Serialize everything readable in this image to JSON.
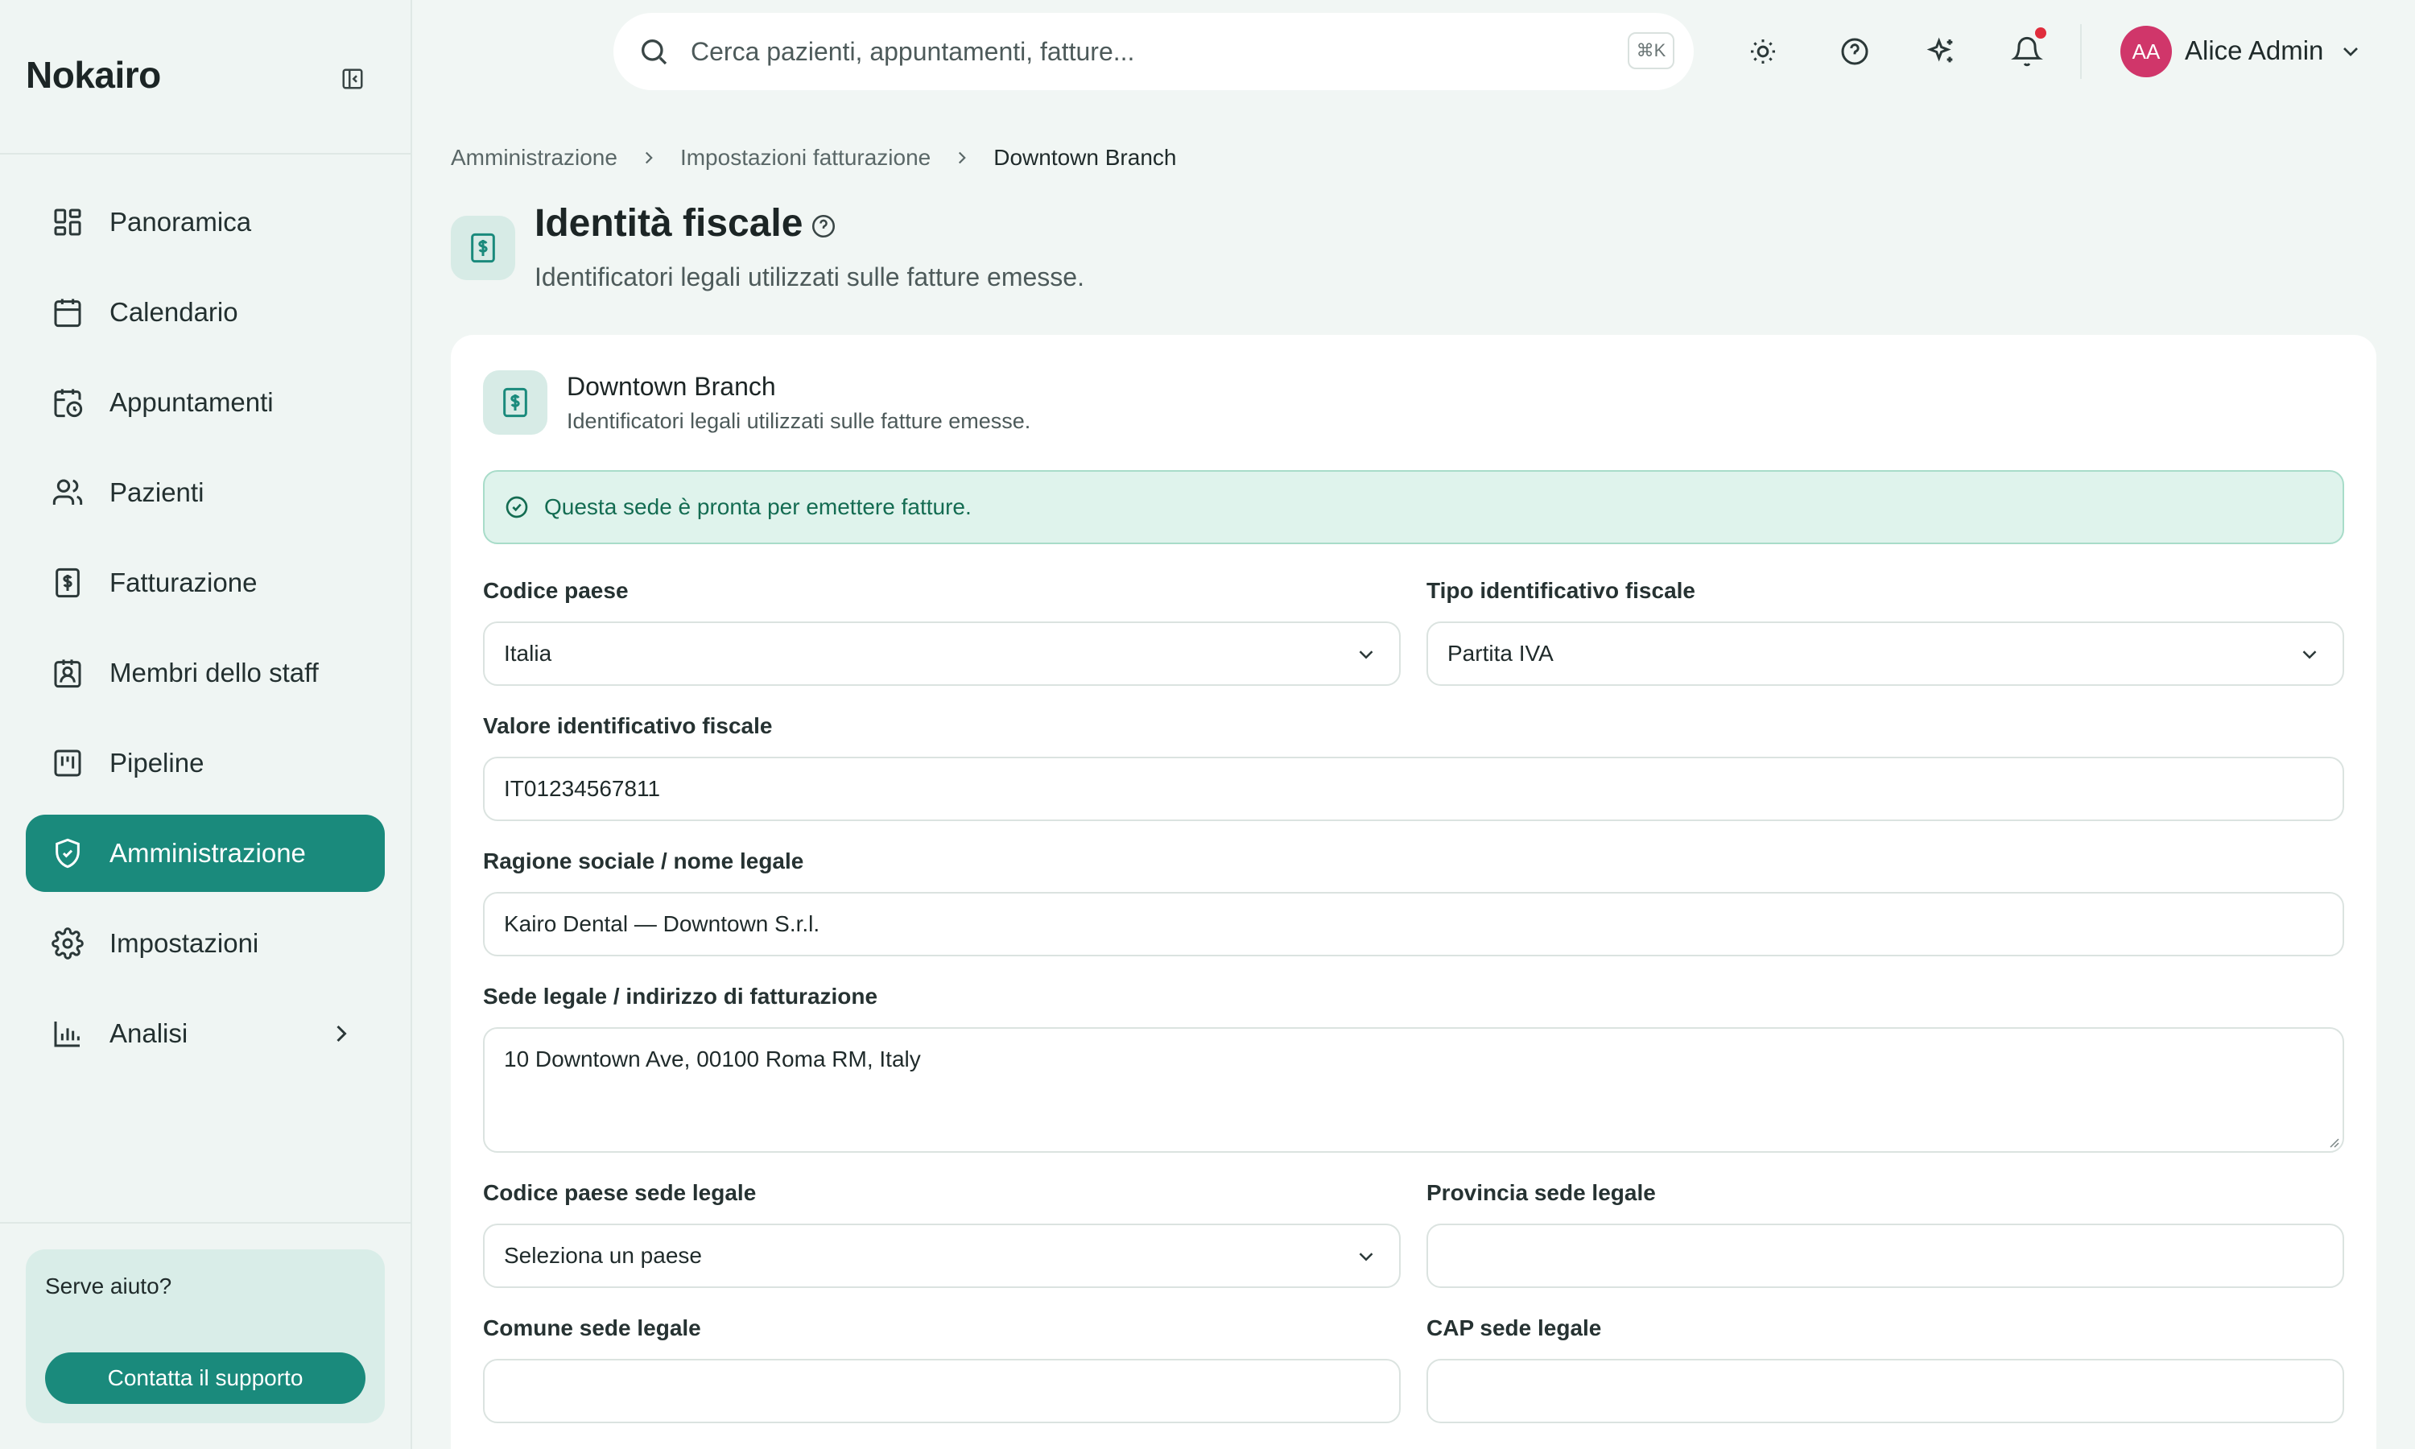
{
  "app": {
    "brand": "Nokairo"
  },
  "sidebar": {
    "items": [
      {
        "label": "Panoramica",
        "icon": "dashboard-icon"
      },
      {
        "label": "Calendario",
        "icon": "calendar-icon"
      },
      {
        "label": "Appuntamenti",
        "icon": "calendar-clock-icon"
      },
      {
        "label": "Pazienti",
        "icon": "users-icon"
      },
      {
        "label": "Fatturazione",
        "icon": "receipt-icon"
      },
      {
        "label": "Membri dello staff",
        "icon": "id-badge-icon"
      },
      {
        "label": "Pipeline",
        "icon": "kanban-icon"
      },
      {
        "label": "Amministrazione",
        "icon": "shield-icon",
        "active": true
      },
      {
        "label": "Impostazioni",
        "icon": "gear-icon"
      },
      {
        "label": "Analisi",
        "icon": "bar-chart-icon"
      }
    ],
    "help": {
      "title": "Serve aiuto?",
      "button": "Contatta il supporto"
    }
  },
  "topbar": {
    "search_placeholder": "Cerca pazienti, appuntamenti, fatture...",
    "shortcut": "⌘K",
    "user": {
      "initials": "AA",
      "name": "Alice Admin"
    }
  },
  "breadcrumb": [
    "Amministrazione",
    "Impostazioni fatturazione",
    "Downtown Branch"
  ],
  "page": {
    "title": "Identità fiscale",
    "subtitle": "Identificatori legali utilizzati sulle fatture emesse."
  },
  "card": {
    "title": "Downtown Branch",
    "subtitle": "Identificatori legali utilizzati sulle fatture emesse.",
    "alert": "Questa sede è pronta per emettere fatture."
  },
  "form": {
    "country_code": {
      "label": "Codice paese",
      "value": "Italia"
    },
    "tax_id_type": {
      "label": "Tipo identificativo fiscale",
      "value": "Partita IVA"
    },
    "tax_id_value": {
      "label": "Valore identificativo fiscale",
      "value": "IT01234567811"
    },
    "legal_name": {
      "label": "Ragione sociale / nome legale",
      "value": "Kairo Dental — Downtown S.r.l."
    },
    "legal_address": {
      "label": "Sede legale / indirizzo di fatturazione",
      "value": "10 Downtown Ave, 00100 Roma RM, Italy"
    },
    "legal_country": {
      "label": "Codice paese sede legale",
      "value": "Seleziona un paese"
    },
    "legal_province": {
      "label": "Provincia sede legale",
      "value": ""
    },
    "legal_city": {
      "label": "Comune sede legale",
      "value": ""
    },
    "legal_zip": {
      "label": "CAP sede legale",
      "value": ""
    }
  },
  "colors": {
    "accent": "#1a8a7c",
    "success_bg": "#dff3ec",
    "notification": "#e02d3c",
    "avatar": "#d0366a"
  }
}
